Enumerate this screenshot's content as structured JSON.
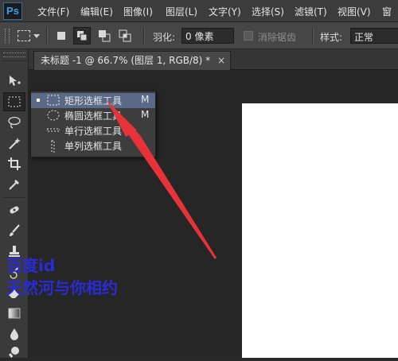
{
  "app": {
    "logo": "Ps"
  },
  "menubar": {
    "items": [
      "文件(F)",
      "编辑(E)",
      "图像(I)",
      "图层(L)",
      "文字(Y)",
      "选择(S)",
      "滤镜(T)",
      "视图(V)",
      "窗"
    ]
  },
  "options": {
    "feather_label": "羽化:",
    "feather_value": "0 像素",
    "antialias_label": "消除锯齿",
    "style_label": "样式:",
    "style_value": "正常"
  },
  "document_tab": {
    "title": "未标题 -1 @ 66.7% (图层 1, RGB/8) *",
    "close": "×"
  },
  "tool_flyout": {
    "items": [
      {
        "label": "矩形选框工具",
        "key": "M",
        "icon": "rect-marquee-icon",
        "selected": true
      },
      {
        "label": "椭圆选框工具",
        "key": "M",
        "icon": "ellipse-marquee-icon",
        "selected": false
      },
      {
        "label": "单行选框工具",
        "key": "",
        "icon": "single-row-marquee-icon",
        "selected": false
      },
      {
        "label": "单列选框工具",
        "key": "",
        "icon": "single-column-marquee-icon",
        "selected": false
      }
    ]
  },
  "tools": [
    "move-tool-icon",
    "rect-marquee-tool-icon",
    "lasso-tool-icon",
    "magic-wand-tool-icon",
    "crop-tool-icon",
    "eyedropper-tool-icon",
    "spot-healing-tool-icon",
    "brush-tool-icon",
    "clone-stamp-tool-icon",
    "history-brush-tool-icon",
    "eraser-tool-icon",
    "gradient-tool-icon",
    "blur-tool-icon",
    "dodge-tool-icon"
  ],
  "watermark": {
    "line1": "百度id",
    "line2": "天然河与你相约"
  },
  "colors": {
    "accent_arrow": "#e8323a",
    "watermark": "#2a2ad6",
    "selected_item": "#5a6a86",
    "canvas": "#ffffff"
  }
}
